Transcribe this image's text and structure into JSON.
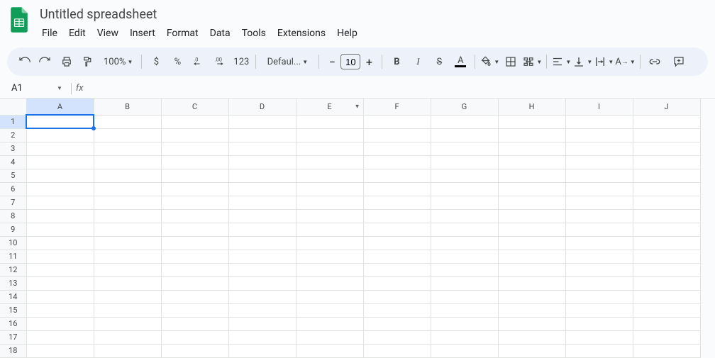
{
  "header": {
    "title": "Untitled spreadsheet",
    "menu": [
      "File",
      "Edit",
      "View",
      "Insert",
      "Format",
      "Data",
      "Tools",
      "Extensions",
      "Help"
    ]
  },
  "toolbar": {
    "zoom": "100%",
    "currency": "$",
    "percent": "%",
    "dec_dec": ".0",
    "inc_dec": ".00",
    "num_fmt": "123",
    "font": "Defaul...",
    "font_size": "10",
    "bold": "B",
    "italic": "I"
  },
  "namebox": {
    "ref": "A1",
    "fx": "fx"
  },
  "grid": {
    "columns": [
      "A",
      "B",
      "C",
      "D",
      "E",
      "F",
      "G",
      "H",
      "I",
      "J"
    ],
    "rows": [
      1,
      2,
      3,
      4,
      5,
      6,
      7,
      8,
      9,
      10,
      11,
      12,
      13,
      14,
      15,
      16,
      17,
      18
    ],
    "filter_col": "E",
    "selected": {
      "row": 1,
      "col": "A"
    }
  }
}
